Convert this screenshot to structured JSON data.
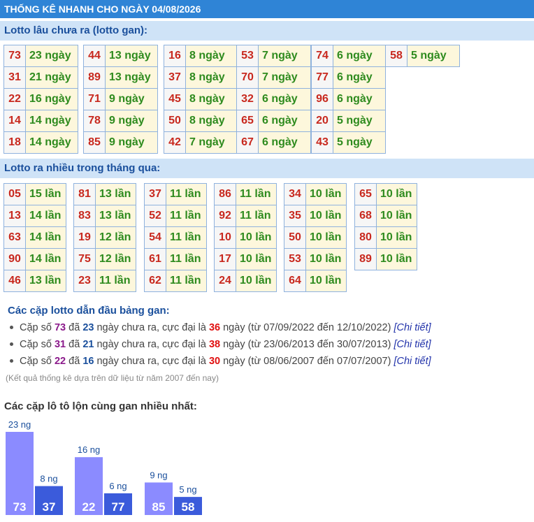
{
  "header": {
    "title": "THỐNG KÊ NHANH CHO NGÀY 04/08/2026"
  },
  "gan_section": {
    "title": "Lotto lâu chưa ra (lotto gan):",
    "columns": [
      [
        [
          "73",
          "23 ngày"
        ],
        [
          "31",
          "21 ngày"
        ],
        [
          "22",
          "16 ngày"
        ],
        [
          "14",
          "14 ngày"
        ],
        [
          "18",
          "14 ngày"
        ]
      ],
      [
        [
          "44",
          "13 ngày"
        ],
        [
          "89",
          "13 ngày"
        ],
        [
          "71",
          "9 ngày"
        ],
        [
          "78",
          "9 ngày"
        ],
        [
          "85",
          "9 ngày"
        ]
      ],
      [
        [
          "16",
          "8 ngày"
        ],
        [
          "37",
          "8 ngày"
        ],
        [
          "45",
          "8 ngày"
        ],
        [
          "50",
          "8 ngày"
        ],
        [
          "42",
          "7 ngày"
        ]
      ],
      [
        [
          "53",
          "7 ngày"
        ],
        [
          "70",
          "7 ngày"
        ],
        [
          "32",
          "6 ngày"
        ],
        [
          "65",
          "6 ngày"
        ],
        [
          "67",
          "6 ngày"
        ]
      ],
      [
        [
          "74",
          "6 ngày"
        ],
        [
          "77",
          "6 ngày"
        ],
        [
          "96",
          "6 ngày"
        ],
        [
          "20",
          "5 ngày"
        ],
        [
          "43",
          "5 ngày"
        ]
      ],
      [
        [
          "58",
          "5 ngày"
        ]
      ]
    ]
  },
  "frequent_section": {
    "title": "Lotto ra nhiều trong tháng qua:",
    "columns": [
      [
        [
          "05",
          "15 lần"
        ],
        [
          "13",
          "14 lần"
        ],
        [
          "63",
          "14 lần"
        ],
        [
          "90",
          "14 lần"
        ],
        [
          "46",
          "13 lần"
        ]
      ],
      [
        [
          "81",
          "13 lần"
        ],
        [
          "83",
          "13 lần"
        ],
        [
          "19",
          "12 lần"
        ],
        [
          "75",
          "12 lần"
        ],
        [
          "23",
          "11 lần"
        ]
      ],
      [
        [
          "37",
          "11 lần"
        ],
        [
          "52",
          "11 lần"
        ],
        [
          "54",
          "11 lần"
        ],
        [
          "61",
          "11 lần"
        ],
        [
          "62",
          "11 lần"
        ]
      ],
      [
        [
          "86",
          "11 lần"
        ],
        [
          "92",
          "11 lần"
        ],
        [
          "10",
          "10 lần"
        ],
        [
          "17",
          "10 lần"
        ],
        [
          "24",
          "10 lần"
        ]
      ],
      [
        [
          "34",
          "10 lần"
        ],
        [
          "35",
          "10 lần"
        ],
        [
          "50",
          "10 lần"
        ],
        [
          "53",
          "10 lần"
        ],
        [
          "64",
          "10 lần"
        ]
      ],
      [
        [
          "65",
          "10 lần"
        ],
        [
          "68",
          "10 lần"
        ],
        [
          "80",
          "10 lần"
        ],
        [
          "89",
          "10 lần"
        ]
      ]
    ]
  },
  "pairs": {
    "title": "Các cặp lotto dẫn đầu bảng gan:",
    "items": [
      {
        "pre": "Cặp số ",
        "num": "73",
        "mid1": " đã ",
        "days": "23",
        "mid2": " ngày chưa ra, cực đại là ",
        "max": "36",
        "mid3": " ngày (từ 07/09/2022 đến 12/10/2022) ",
        "link": "[Chi tiết]"
      },
      {
        "pre": "Cặp số ",
        "num": "31",
        "mid1": " đã ",
        "days": "21",
        "mid2": " ngày chưa ra, cực đại là ",
        "max": "38",
        "mid3": " ngày (từ 23/06/2013 đến 30/07/2013) ",
        "link": "[Chi tiết]"
      },
      {
        "pre": "Cặp số ",
        "num": "22",
        "mid1": " đã ",
        "days": "16",
        "mid2": " ngày chưa ra, cực đại là ",
        "max": "30",
        "mid3": " ngày (từ 08/06/2007 đến 07/07/2007) ",
        "link": "[Chi tiết]"
      }
    ],
    "note": "(Kết quả thống kê dựa trên dữ liệu từ năm 2007 đến nay)"
  },
  "chart_data": {
    "type": "bar",
    "title": "Các cặp lô tô lộn cùng gan nhiều nhất:",
    "categories": [
      "73",
      "37",
      "22",
      "77",
      "85",
      "58"
    ],
    "values": [
      23,
      8,
      16,
      6,
      9,
      5
    ],
    "labels": [
      "23 ng",
      "8 ng",
      "16 ng",
      "6 ng",
      "9 ng",
      "5 ng"
    ],
    "colors": [
      "#8b8bff",
      "#3b5bdb",
      "#8b8bff",
      "#3b5bdb",
      "#8b8bff",
      "#3b5bdb"
    ],
    "ylim": [
      0,
      23
    ],
    "grid": false
  }
}
